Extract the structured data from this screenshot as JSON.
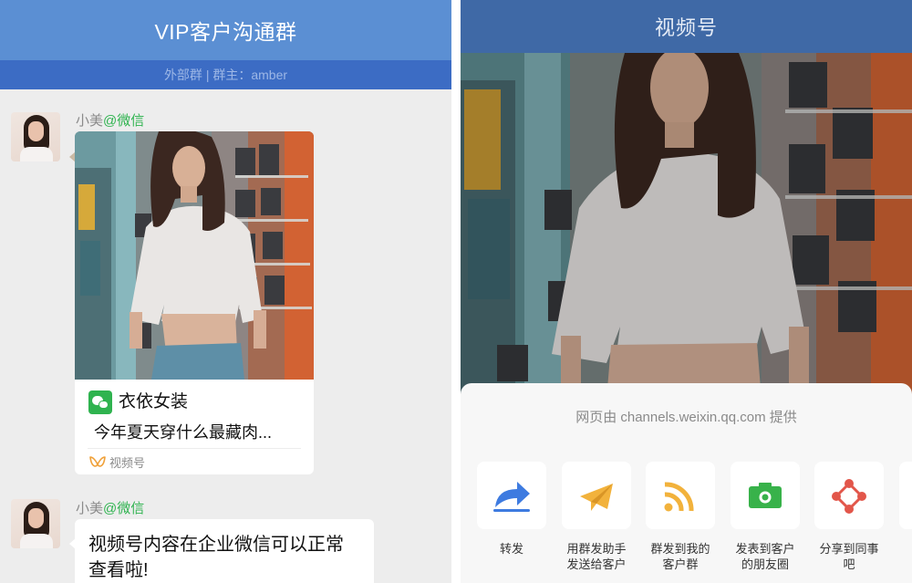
{
  "left": {
    "header": {
      "title": "VIP客户沟通群"
    },
    "subheader": {
      "text": "外部群 | 群主：amber"
    },
    "messages": [
      {
        "sender_name": "小美",
        "sender_tag": "@微信",
        "card": {
          "account_name": "衣依女装",
          "description": "今年夏天穿什么最藏肉...",
          "source_label": "视频号"
        }
      },
      {
        "sender_name": "小美",
        "sender_tag": "@微信",
        "text_line1": "视频号内容在企业微信可以正常",
        "text_line2": "查看啦!"
      }
    ]
  },
  "right": {
    "header": {
      "title": "视频号"
    },
    "sheet": {
      "provider_text": "网页由 channels.weixin.qq.com 提供",
      "actions": [
        {
          "icon": "forward-arrow-icon",
          "label_line1": "转发",
          "label_line2": ""
        },
        {
          "icon": "paper-plane-icon",
          "label_line1": "用群发助手",
          "label_line2": "发送给客户"
        },
        {
          "icon": "rss-broadcast-icon",
          "label_line1": "群发到我的",
          "label_line2": "客户群"
        },
        {
          "icon": "camera-icon",
          "label_line1": "发表到客户",
          "label_line2": "的朋友圈"
        },
        {
          "icon": "share-nodes-icon",
          "label_line1": "分享到同事",
          "label_line2": "吧"
        }
      ]
    }
  },
  "colors": {
    "left_header": "#5b8fd3",
    "left_subheader": "#3c6cc4",
    "right_header": "#3f69a6",
    "wechat_green": "#2fb34f",
    "forward_blue": "#3e7be0",
    "plane_yellow": "#f2b23c",
    "rss_yellow": "#f2b23c",
    "camera_green": "#38b24a",
    "share_red": "#e2564a"
  }
}
